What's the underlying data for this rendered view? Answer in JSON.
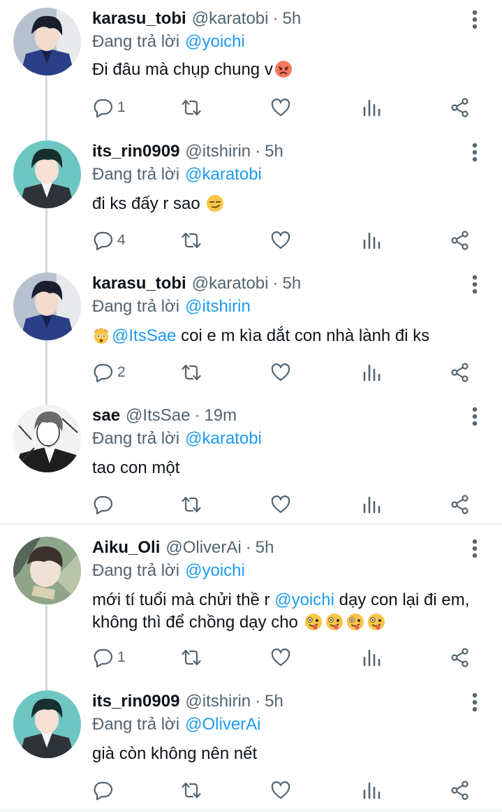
{
  "replying_prefix": "Đang trả lời",
  "tweets": [
    {
      "name": "karasu_tobi",
      "handle": "@karatobi",
      "time": "5h",
      "reply_to": "@yoichi",
      "text": "Đi đâu mà chụp chung v",
      "replies": "1"
    },
    {
      "name": "its_rin0909",
      "handle": "@itshirin",
      "time": "5h",
      "reply_to": "@karatobi",
      "text": "đi ks đấy r sao",
      "replies": "4"
    },
    {
      "name": "karasu_tobi",
      "handle": "@karatobi",
      "time": "5h",
      "reply_to": "@itshirin",
      "mention": "@ItsSae",
      "text": " coi e m kìa dắt con nhà lành đi ks",
      "replies": "2"
    },
    {
      "name": "sae",
      "handle": "@ItsSae",
      "time": "19m",
      "reply_to": "@karatobi",
      "text": "tao con một",
      "replies": ""
    },
    {
      "name": "Aiku_Oli",
      "handle": "@OliverAi",
      "time": "5h",
      "reply_to": "@yoichi",
      "text_a": "mới tí tuổi mà chửi thề r ",
      "mention": "@yoichi",
      "text_b": " dạy con lại đi em, không thì để chồng dạy cho ",
      "replies": "1"
    },
    {
      "name": "its_rin0909",
      "handle": "@itshirin",
      "time": "5h",
      "reply_to": "@OliverAi",
      "text": "già còn không nên nết",
      "replies": ""
    }
  ],
  "icons": {
    "reply": "reply-icon",
    "retweet": "retweet-icon",
    "like": "heart-icon",
    "stats": "stats-icon",
    "share": "share-icon",
    "more": "more-vertical-icon"
  },
  "colors": {
    "mention": "#1d9bf0",
    "secondary_text": "#536471",
    "thread_line": "#cfd9de"
  }
}
